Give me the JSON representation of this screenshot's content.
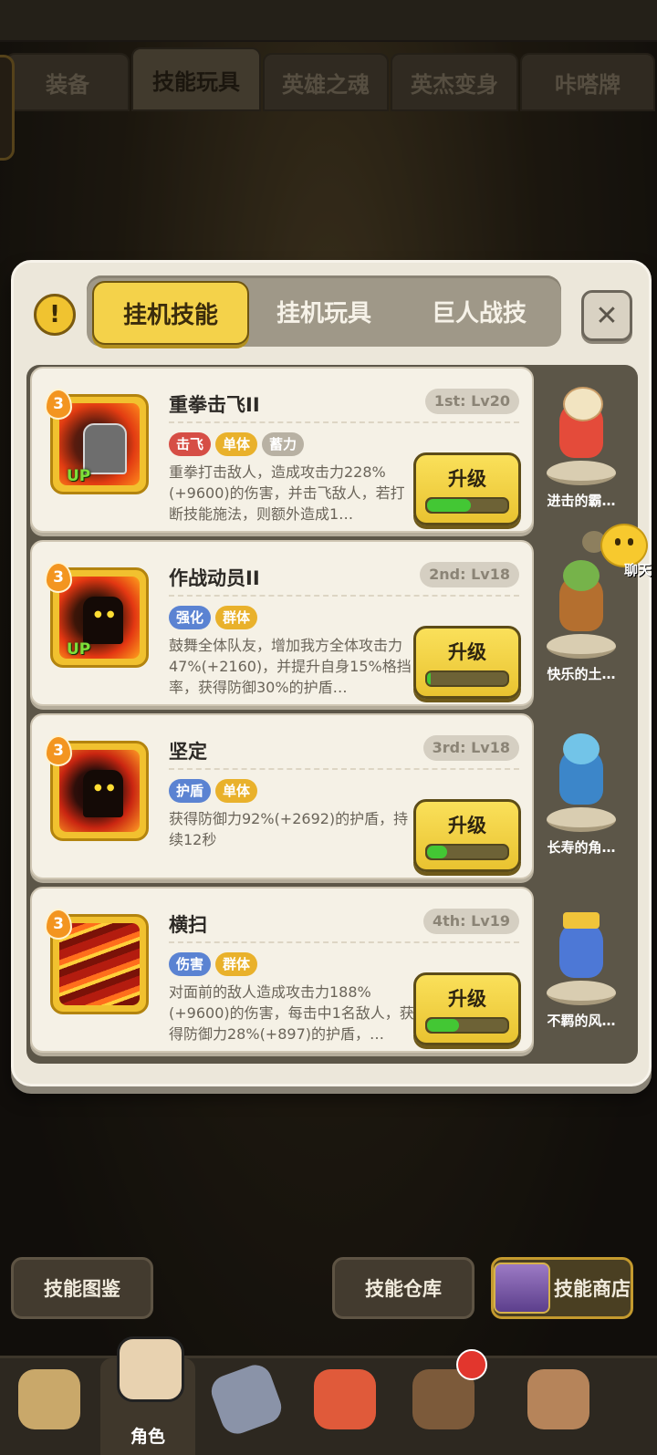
{
  "top_tabs": [
    "装备",
    "技能玩具",
    "英雄之魂",
    "英杰变身",
    "咔嗒牌"
  ],
  "top_active": 1,
  "dialog": {
    "warn_symbol": "!",
    "tabs": [
      "挂机技能",
      "挂机玩具",
      "巨人战技"
    ],
    "active_tab": 0,
    "close_symbol": "✕"
  },
  "skills": [
    {
      "name": "重拳击飞II",
      "rank": "1st: Lv20",
      "level_badge": "3",
      "up": "UP",
      "tags": [
        {
          "text": "击飞",
          "color": "red"
        },
        {
          "text": "单体",
          "color": "yellow"
        },
        {
          "text": "蓄力",
          "color": "grey"
        }
      ],
      "desc": "重拳打击敌人，造成攻击力228%(+9600)的伤害，并击飞敌人，若打断技能施法，则额外造成1…",
      "button": "升级",
      "progress": 0.55,
      "pet_name": "进击的霸…"
    },
    {
      "name": "作战动员II",
      "rank": "2nd: Lv18",
      "level_badge": "3",
      "up": "UP",
      "tags": [
        {
          "text": "强化",
          "color": "blue"
        },
        {
          "text": "群体",
          "color": "yellow"
        }
      ],
      "desc": "鼓舞全体队友，增加我方全体攻击力47%(+2160)，并提升自身15%格挡率，获得防御30%的护盾…",
      "button": "升级",
      "progress": 0.05,
      "pet_name": "快乐的土…"
    },
    {
      "name": "坚定",
      "rank": "3rd: Lv18",
      "level_badge": "3",
      "up": "",
      "tags": [
        {
          "text": "护盾",
          "color": "blue"
        },
        {
          "text": "单体",
          "color": "yellow"
        }
      ],
      "desc": "获得防御力92%(+2692)的护盾，持续12秒",
      "button": "升级",
      "progress": 0.25,
      "pet_name": "长寿的角…"
    },
    {
      "name": "横扫",
      "rank": "4th: Lv19",
      "level_badge": "3",
      "up": "",
      "tags": [
        {
          "text": "伤害",
          "color": "blue"
        },
        {
          "text": "群体",
          "color": "yellow"
        }
      ],
      "desc": "对面前的敌人造成攻击力188%(+9600)的伤害，每击中1名敌人，获得防御力28%(+897)的护盾，…",
      "button": "升级",
      "progress": 0.4,
      "pet_name": "不羁的风…"
    }
  ],
  "chat_label": "聊天",
  "bottom_buttons": {
    "codex": "技能图鉴",
    "storage": "技能仓库",
    "shop": "技能商店"
  },
  "nav": {
    "active_label": "角色"
  },
  "colors": {
    "accent_yellow": "#f4d24a",
    "progress_green": "#43c734",
    "tag_red": "#d64e45",
    "tag_blue": "#5b83d2"
  }
}
